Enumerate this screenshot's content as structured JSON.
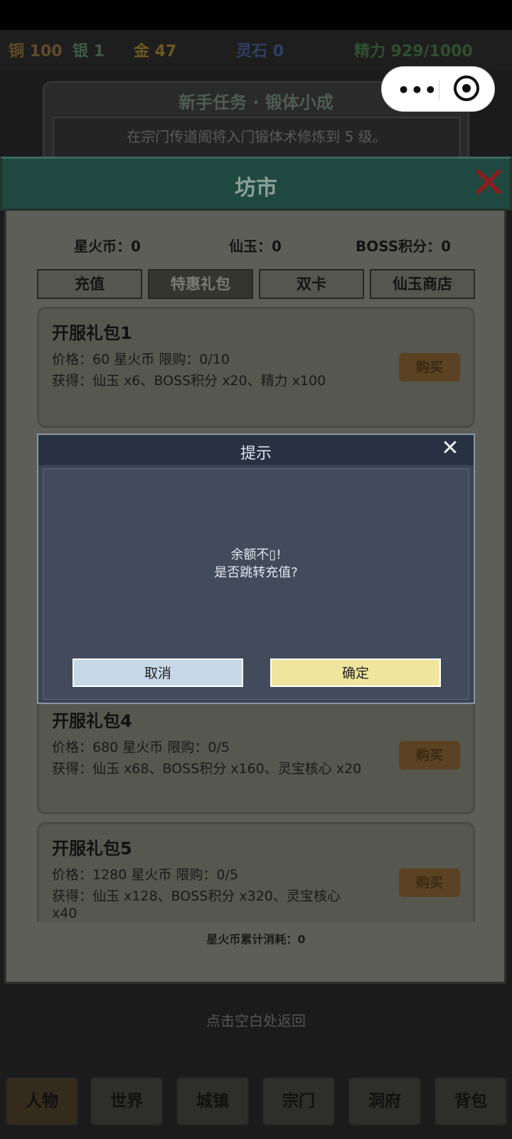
{
  "resources": {
    "copper": "铜 100",
    "silver": "银 1",
    "gold": "金 47",
    "spirit_stone": "灵石 0",
    "energy": "精力 929/1000"
  },
  "quest": {
    "title": "新手任务 · 锻体小成",
    "description": "在宗门传道阁将入门锻体术修炼到 5 级。"
  },
  "market": {
    "title": "坊市",
    "currencies": {
      "starfire": "星火币：0",
      "jade": "仙玉：0",
      "boss_points": "BOSS积分：0"
    },
    "tabs": [
      {
        "label": "充值"
      },
      {
        "label": "特惠礼包"
      },
      {
        "label": "双卡"
      },
      {
        "label": "仙玉商店"
      }
    ],
    "packs": [
      {
        "name": "开服礼包1",
        "price": "价格：60 星火币    限购：0/10",
        "reward": "获得：仙玉 x6、BOSS积分 x20、精力 x100",
        "reward2": "",
        "buy": "购买"
      },
      {
        "name": "开服礼包4",
        "price": "价格：680 星火币    限购：0/5",
        "reward": "获得：仙玉 x68、BOSS积分 x160、灵宝核心 x20",
        "reward2": "",
        "buy": "购买"
      },
      {
        "name": "开服礼包5",
        "price": "价格：1280 星火币    限购：0/5",
        "reward": "获得：仙玉 x128、BOSS积分 x320、灵宝核心",
        "reward2": "x40",
        "buy": "购买"
      }
    ],
    "consumption": "星火币累计消耗：0"
  },
  "back_hint": "点击空白处返回",
  "bottom_nav": [
    {
      "label": "人物"
    },
    {
      "label": "世界"
    },
    {
      "label": "城镇"
    },
    {
      "label": "宗门"
    },
    {
      "label": "洞府"
    },
    {
      "label": "背包"
    }
  ],
  "dialog": {
    "title": "提示",
    "message_line1": "余额不▯!",
    "message_line2": "是否跳转充值?",
    "cancel": "取消",
    "confirm": "确定"
  },
  "colors": {
    "dialog_confirm": "#efe59c",
    "dialog_cancel": "#c6d7e6",
    "panel_header": "#1f4840"
  }
}
